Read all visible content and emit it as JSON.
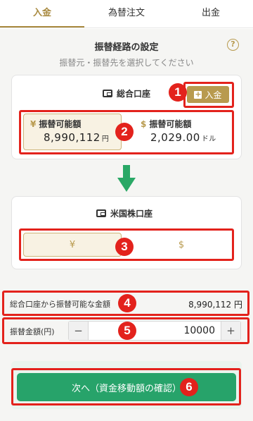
{
  "tabs": [
    {
      "label": "入金",
      "active": true
    },
    {
      "label": "為替注文",
      "active": false
    },
    {
      "label": "出金",
      "active": false
    }
  ],
  "header": {
    "title": "振替経路の設定",
    "subtitle": "振替元・振替先を選択してください",
    "help_label": "?"
  },
  "source_account": {
    "label": "総合口座",
    "deposit_button": "入金",
    "balances": [
      {
        "symbol": "¥",
        "label": "振替可能額",
        "value": "8,990,112",
        "unit": "円",
        "selected": true
      },
      {
        "symbol": "$",
        "label": "振替可能額",
        "value": "2,029.00",
        "unit": "ドル",
        "selected": false
      }
    ]
  },
  "destination_account": {
    "label": "米国株口座",
    "currency_options": [
      {
        "symbol": "¥",
        "selected": true
      },
      {
        "symbol": "$",
        "selected": false
      }
    ]
  },
  "transferable": {
    "label": "総合口座から振替可能な金額",
    "value": "8,990,112 円"
  },
  "amount": {
    "label": "振替金額(円)",
    "value": "10000",
    "minus": "−",
    "plus": "+"
  },
  "next_button": "次へ（資金移動額の確認）",
  "badges": [
    "1",
    "2",
    "3",
    "4",
    "5",
    "6"
  ],
  "colors": {
    "accent_gold": "#b89a4e",
    "annotation_red": "#e3221c",
    "primary_green": "#27a36a",
    "arrow_green": "#2aa866"
  }
}
